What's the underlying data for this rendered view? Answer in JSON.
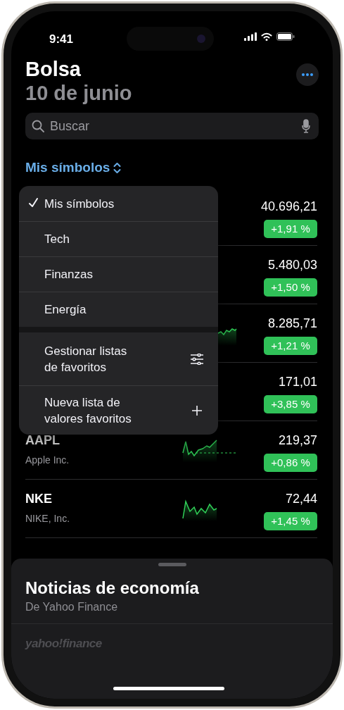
{
  "status_bar": {
    "time": "9:41"
  },
  "header": {
    "title": "Bolsa",
    "date": "10 de junio"
  },
  "search": {
    "placeholder": "Buscar"
  },
  "list_picker": {
    "label": "Mis símbolos"
  },
  "stocks": [
    {
      "price": "40.696,21",
      "change": "+1,91 %"
    },
    {
      "price": "5.480,03",
      "change": "+1,50 %"
    },
    {
      "price": "8.285,71",
      "change": "+1,21 %",
      "chart": true
    },
    {
      "price": "171,01",
      "change": "+3,85 %"
    },
    {
      "symbol": "AAPL",
      "name": "Apple Inc.",
      "price": "219,37",
      "change": "+0,86 %",
      "chart": true
    },
    {
      "symbol": "NKE",
      "name": "NIKE, Inc.",
      "price": "72,44",
      "change": "+1,45 %",
      "chart": true
    }
  ],
  "menu": {
    "items": [
      {
        "kind": "list",
        "label": "Mis símbolos",
        "selected": true
      },
      {
        "kind": "list",
        "label": "Tech",
        "selected": false
      },
      {
        "kind": "list",
        "label": "Finanzas",
        "selected": false
      },
      {
        "kind": "list",
        "label": "Energía",
        "selected": false
      },
      {
        "kind": "manage",
        "label": "Gestionar listas de favoritos"
      },
      {
        "kind": "new",
        "label": "Nueva lista de valores favoritos"
      }
    ]
  },
  "news_sheet": {
    "title": "Noticias de economía",
    "subtitle": "De Yahoo Finance",
    "source_logo": "yahoo!finance"
  }
}
